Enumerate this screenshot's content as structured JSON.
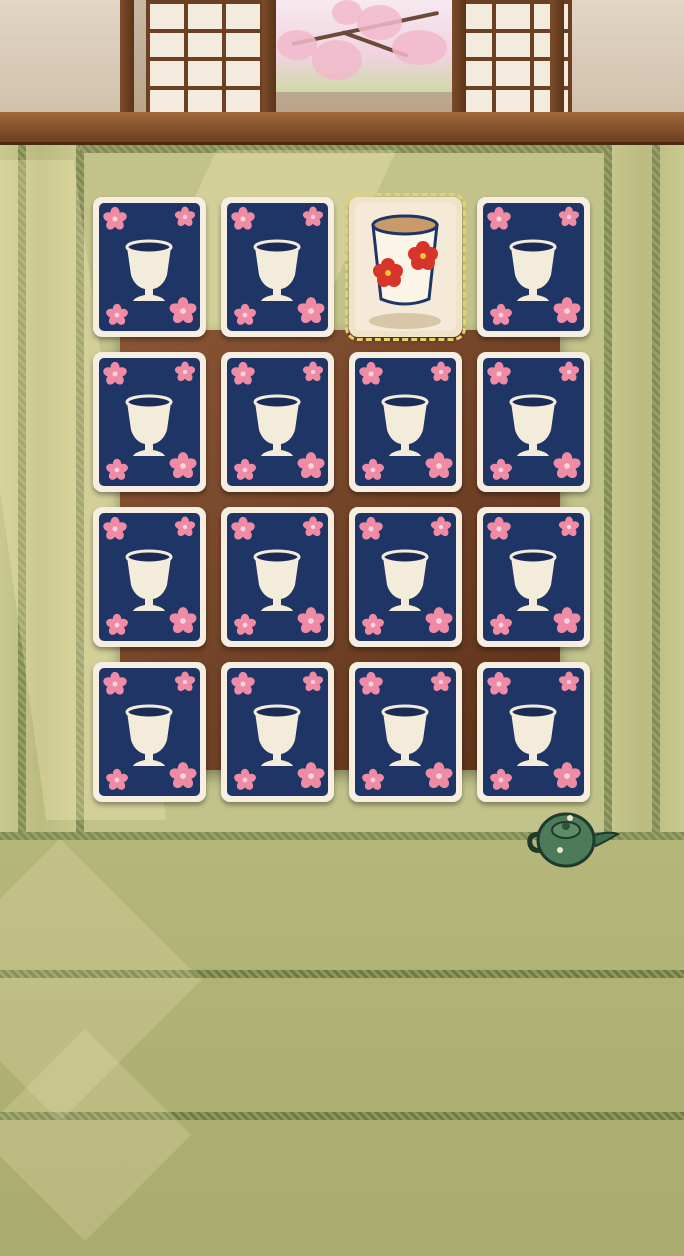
{
  "game": {
    "board": {
      "rows": 4,
      "cols": 4,
      "cards": [
        {
          "state": "face-down",
          "icon": "cup-icon"
        },
        {
          "state": "face-down",
          "icon": "cup-icon"
        },
        {
          "state": "face-up",
          "icon": "plum-blossom-teacup-icon"
        },
        {
          "state": "face-down",
          "icon": "cup-icon"
        },
        {
          "state": "face-down",
          "icon": "cup-icon"
        },
        {
          "state": "face-down",
          "icon": "cup-icon"
        },
        {
          "state": "face-down",
          "icon": "cup-icon"
        },
        {
          "state": "face-down",
          "icon": "cup-icon"
        },
        {
          "state": "face-down",
          "icon": "cup-icon"
        },
        {
          "state": "face-down",
          "icon": "cup-icon"
        },
        {
          "state": "face-down",
          "icon": "cup-icon"
        },
        {
          "state": "face-down",
          "icon": "cup-icon"
        },
        {
          "state": "face-down",
          "icon": "cup-icon"
        },
        {
          "state": "face-down",
          "icon": "cup-icon"
        },
        {
          "state": "face-down",
          "icon": "cup-icon"
        },
        {
          "state": "face-down",
          "icon": "cup-icon"
        }
      ]
    },
    "decor": {
      "teapot_icon": "teapot-icon",
      "background": "tatami-room-with-shoji-and-cherry-blossom-window"
    },
    "colors": {
      "card_back": "#1f3566",
      "card_border": "#f6efe1",
      "blossom": "#ef8ba4",
      "cup": "#f4ecda",
      "plum_red": "#d8352a",
      "highlight": "#e6cf6d"
    }
  }
}
